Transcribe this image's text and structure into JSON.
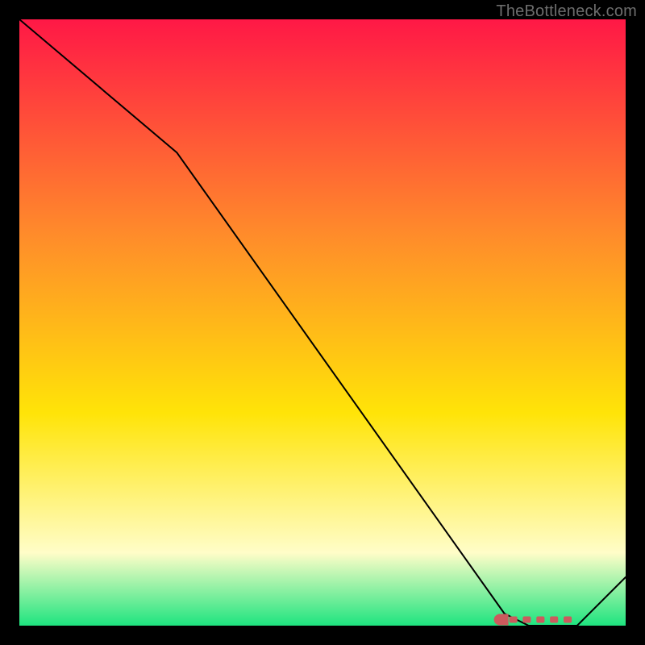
{
  "watermark": "TheBottleneck.com",
  "chart_data": {
    "type": "line",
    "title": "",
    "xlabel": "",
    "ylabel": "",
    "xlim": [
      0,
      100
    ],
    "ylim": [
      0,
      100
    ],
    "background_gradient": {
      "top": "#ff1846",
      "upper_mid": "#ff8a2b",
      "mid": "#ffe408",
      "lower_mid": "#fffdc8",
      "bottom": "#1ee47f"
    },
    "series": [
      {
        "name": "bottleneck-line",
        "color": "#000000",
        "stroke_width": 2,
        "x": [
          0,
          26,
          80,
          84,
          92,
          100
        ],
        "y": [
          100,
          78,
          2,
          0,
          0,
          8
        ]
      },
      {
        "name": "optimal-marker",
        "type": "marker-run",
        "color": "#cc5a5d",
        "x_start": 80,
        "x_end": 92,
        "y": 1
      }
    ]
  }
}
